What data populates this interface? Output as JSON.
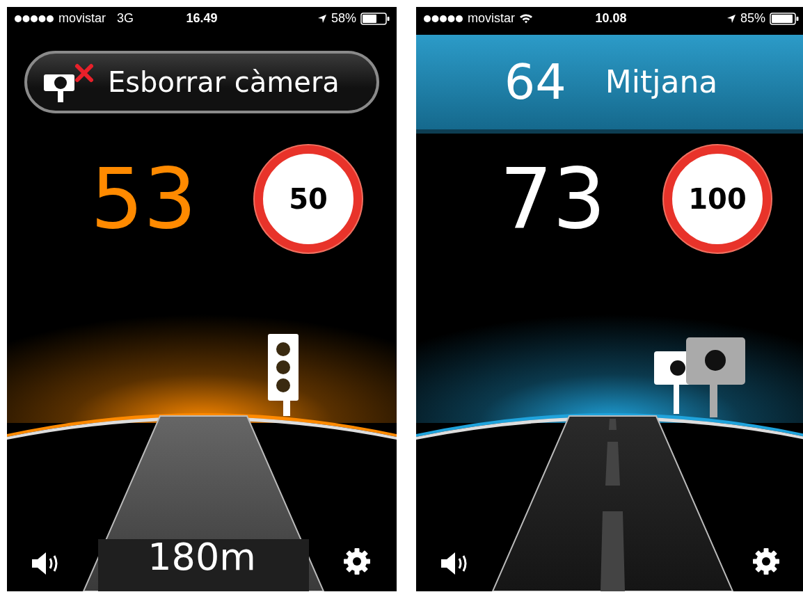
{
  "screens": [
    {
      "status_bar": {
        "carrier": "movistar",
        "network": "3G",
        "time": "16.49",
        "battery": "58%"
      },
      "header": {
        "kind": "button",
        "label": "Esborrar càmera"
      },
      "speed": {
        "value": "53",
        "color": "#ff8a00"
      },
      "speed_limit": "50",
      "scene": {
        "kind": "traffic-light",
        "color": "#ff8a00",
        "dashed": false
      },
      "distance": "180m"
    },
    {
      "status_bar": {
        "carrier": "movistar",
        "time": "10.08",
        "battery": "85%"
      },
      "header": {
        "kind": "banner",
        "value": "64",
        "label": "Mitjana"
      },
      "speed": {
        "value": "73",
        "color": "#ffffff"
      },
      "speed_limit": "100",
      "scene": {
        "kind": "cameras",
        "color": "#1fa3dc",
        "dashed": true
      }
    }
  ]
}
